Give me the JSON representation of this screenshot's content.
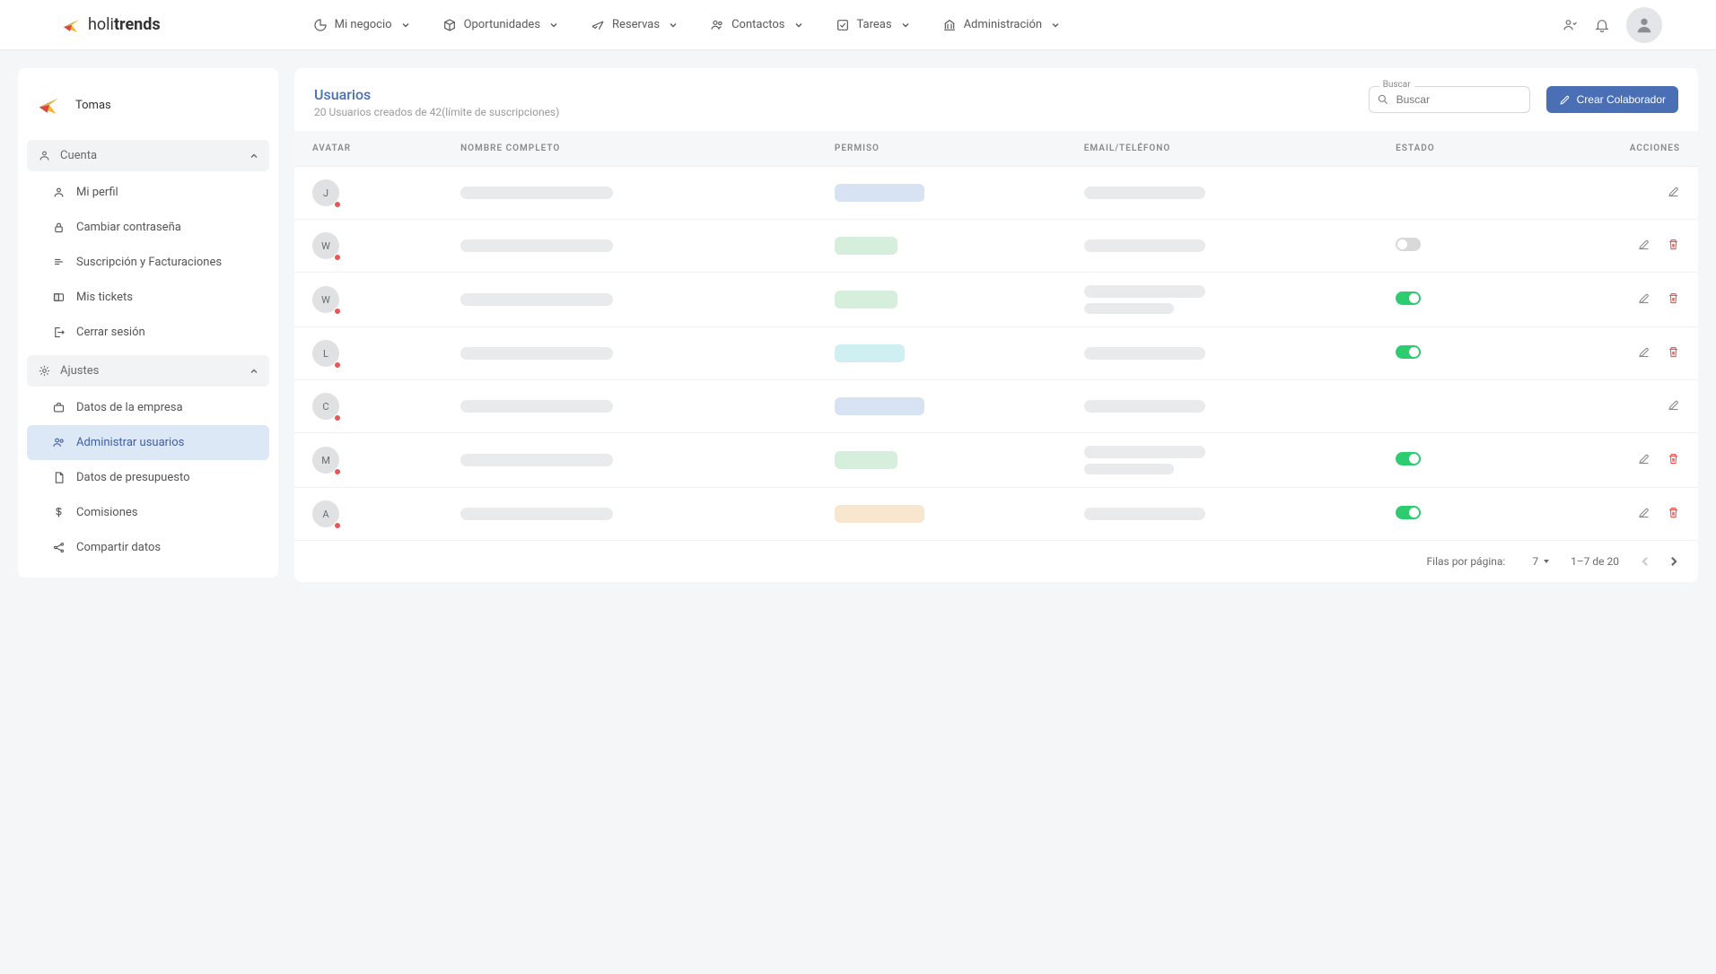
{
  "brand": {
    "name1": "holi",
    "name2": "trends"
  },
  "nav": {
    "my_business": "Mi negocio",
    "opportunities": "Oportunidades",
    "bookings": "Reservas",
    "contacts": "Contactos",
    "tasks": "Tareas",
    "admin": "Administración"
  },
  "sidebar": {
    "user_name": "Tomas",
    "group_account": "Cuenta",
    "group_settings": "Ajustes",
    "account_items": {
      "profile": "Mi perfil",
      "password": "Cambiar contraseña",
      "subscription": "Suscripción y Facturaciones",
      "tickets": "Mis tickets",
      "logout": "Cerrar sesión"
    },
    "settings_items": {
      "company": "Datos de la empresa",
      "users": "Administrar usuarios",
      "budget": "Datos de presupuesto",
      "commissions": "Comisiones",
      "share": "Compartir datos"
    }
  },
  "page": {
    "title": "Usuarios",
    "subtitle": "20 Usuarios creados de 42(límite de suscripciones)",
    "search_label": "Buscar",
    "search_placeholder": "Buscar",
    "create_btn": "Crear Colaborador"
  },
  "table": {
    "headers": {
      "avatar": "AVATAR",
      "name": "NOMBRE COMPLETO",
      "perm": "PERMISO",
      "email": "EMAIL/TELÉFONO",
      "state": "ESTADO",
      "actions": "ACCIONES"
    },
    "rows": [
      {
        "initial": "J",
        "chip": "blue",
        "chip_w": "",
        "toggle": null,
        "del": false,
        "two_line": false
      },
      {
        "initial": "W",
        "chip": "green",
        "chip_w": "sm",
        "toggle": false,
        "del": true,
        "two_line": false
      },
      {
        "initial": "W",
        "chip": "green",
        "chip_w": "sm",
        "toggle": true,
        "del": true,
        "two_line": true
      },
      {
        "initial": "L",
        "chip": "cyan",
        "chip_w": "md",
        "toggle": true,
        "del": true,
        "two_line": false
      },
      {
        "initial": "C",
        "chip": "blue",
        "chip_w": "",
        "toggle": null,
        "del": false,
        "two_line": false
      },
      {
        "initial": "M",
        "chip": "green",
        "chip_w": "sm",
        "toggle": true,
        "del": true,
        "two_line": true
      },
      {
        "initial": "A",
        "chip": "orange",
        "chip_w": "",
        "toggle": true,
        "del": true,
        "two_line": false
      }
    ]
  },
  "pager": {
    "rows_per_page": "Filas por página:",
    "page_size": "7",
    "range": "1–7 de 20"
  }
}
